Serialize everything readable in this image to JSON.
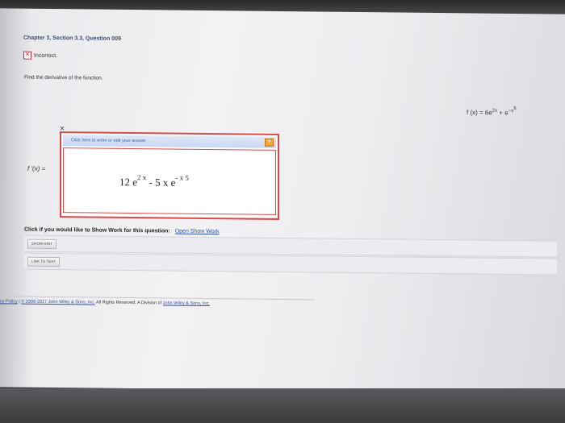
{
  "question": {
    "heading": "Chapter 3, Section 3.3, Question 009",
    "status_label": "Incorrect.",
    "status_icon": "incorrect-x-icon",
    "instruction": "Find the derivative of the function.",
    "given_function": {
      "lhs": "f (x) = 6e",
      "exp1": "2x",
      "mid": " + e",
      "exp2": "−x",
      "exp2b": "5"
    }
  },
  "answer": {
    "hint": "Click here to enter or edit your answer",
    "label": "f ′(x) =",
    "coef1": "12 e",
    "exp1": "2 x",
    "mid": " -  5 x e",
    "exp2": "- x 5"
  },
  "show_work": {
    "prompt": "Click if you would like to Show Work for this question:",
    "link": "Open Show Work"
  },
  "buttons": {
    "hint": "SHOW HINT",
    "text_link": "LINK TO TEXT"
  },
  "footer": {
    "policy": "cy Policy",
    "separator": "|",
    "copyright": "© 2000-2017 John Wiley & Sons, Inc.",
    "rights": "All Rights Reserved. A Division of",
    "company": "John Wiley & Sons, Inc."
  },
  "colors": {
    "error": "#d84a4a",
    "link": "#2d4fa3",
    "heading": "#3b4a6b"
  }
}
